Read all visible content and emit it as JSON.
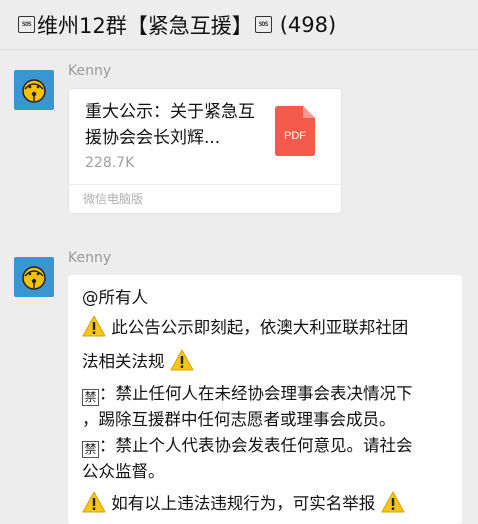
{
  "header": {
    "sos_left": "SOS",
    "title": "维州12群【紧急互援】",
    "sos_right": "SOS",
    "count": "(498)"
  },
  "messages": [
    {
      "sender": "Kenny",
      "type": "file",
      "file": {
        "title": "重大公示：关于紧急互援协会会长刘辉...",
        "size": "228.7K",
        "icon_label": "PDF",
        "footer": "微信电脑版"
      }
    },
    {
      "sender": "Kenny",
      "type": "text",
      "mention": "@所有人",
      "line1": "此公告公示即刻起，依澳大利亚联邦社团",
      "line2": "法相关法规",
      "ban_label": "禁",
      "rule1_a": "：禁止任何人在未经协会理事会表决情况下",
      "rule1_b": "，踢除互援群中任何志愿者或理事会成员。",
      "rule2_a": "：禁止个人代表协会发表任何意见。请社会",
      "rule2_b": "公众监督。",
      "closing": "如有以上违法违规行为，可实名举报"
    }
  ],
  "colors": {
    "background": "#ededed",
    "avatar": "#3a95d1",
    "pdf": "#f35a4a",
    "warning": "#f5c518"
  }
}
